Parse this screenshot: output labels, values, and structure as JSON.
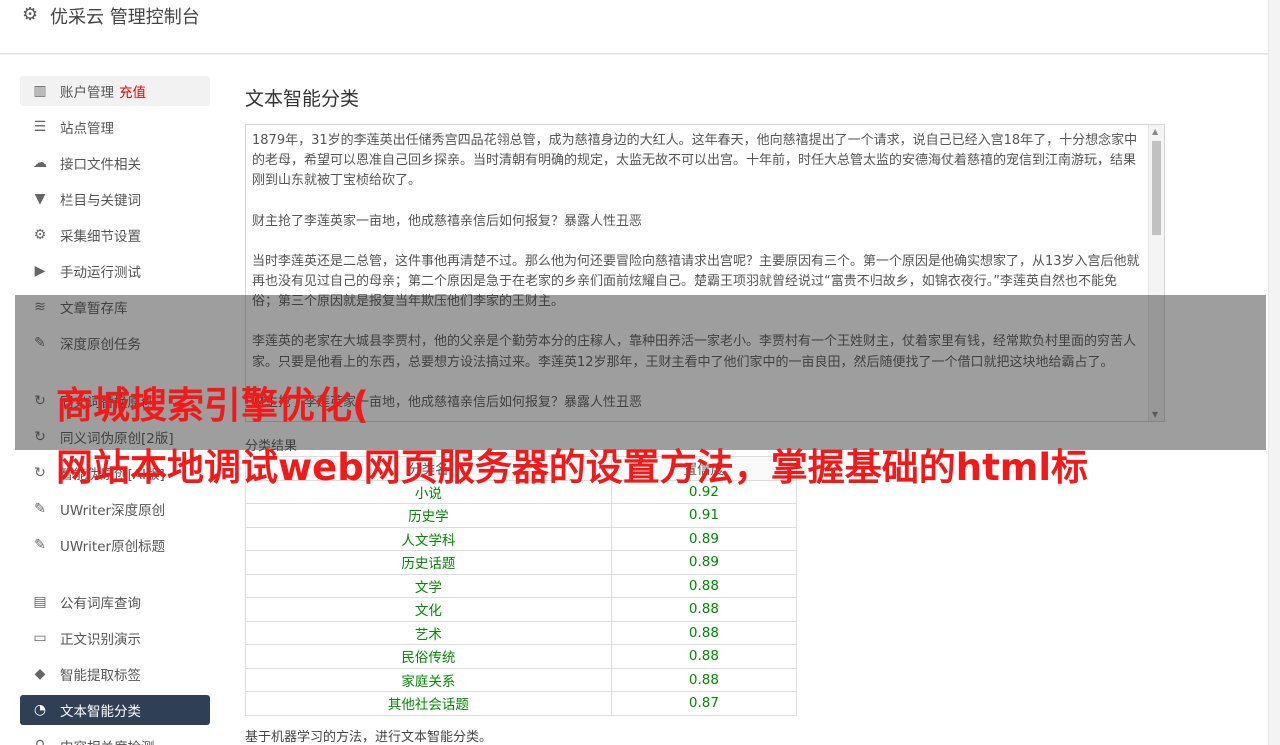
{
  "header": {
    "gear_icon": "gear-icon",
    "title": "优采云 管理控制台"
  },
  "sidebar": {
    "items": [
      {
        "icon": "bar-chart-icon",
        "glyph": "▥",
        "label": "账户管理",
        "badge": "充值"
      },
      {
        "icon": "server-icon",
        "glyph": "☰",
        "label": "站点管理"
      },
      {
        "icon": "cloud-upload-icon",
        "glyph": "☁",
        "label": "接口文件相关"
      },
      {
        "icon": "filter-icon",
        "glyph": "▼",
        "label": "栏目与关键词"
      },
      {
        "icon": "gears-icon",
        "glyph": "⚙",
        "label": "采集细节设置"
      },
      {
        "icon": "play-icon",
        "glyph": "▶",
        "label": "手动运行测试"
      },
      {
        "icon": "database-icon",
        "glyph": "≋",
        "label": "文章暂存库"
      },
      {
        "icon": "edit-icon",
        "glyph": "✎",
        "label": "深度原创任务"
      },
      {
        "icon": "refresh-icon",
        "glyph": "↻",
        "label": "同义词替换原创"
      },
      {
        "icon": "refresh-icon",
        "glyph": "↻",
        "label": "同义词伪原创[2版]"
      },
      {
        "icon": "refresh-icon",
        "glyph": "↻",
        "label": "智能伪原创[AI版]"
      },
      {
        "icon": "edit-icon",
        "glyph": "✎",
        "label": "UWriter深度原创"
      },
      {
        "icon": "edit-icon",
        "glyph": "✎",
        "label": "UWriter原创标题"
      },
      {
        "icon": "book-icon",
        "glyph": "▤",
        "label": "公有词库查询"
      },
      {
        "icon": "monitor-icon",
        "glyph": "▭",
        "label": "正文识别演示"
      },
      {
        "icon": "tag-icon",
        "glyph": "◆",
        "label": "智能提取标签"
      },
      {
        "icon": "pie-chart-icon",
        "glyph": "◔",
        "label": "文本智能分类"
      },
      {
        "icon": "search-icon",
        "glyph": "⚲",
        "label": "内容相关度检测"
      }
    ]
  },
  "main": {
    "title": "文本智能分类",
    "paragraphs": [
      "1879年，31岁的李莲英出任储秀宫四品花翎总管，成为慈禧身边的大红人。这年春天，他向慈禧提出了一个请求，说自己已经入宫18年了，十分想念家中的老母，希望可以恩准自己回乡探亲。当时清朝有明确的规定，太监无故不可以出宫。十年前，时任大总管太监的安德海仗着慈禧的宠信到江南游玩，结果刚到山东就被丁宝桢给砍了。",
      "财主抢了李莲英家一亩地，他成慈禧亲信后如何报复？暴露人性丑恶",
      "当时李莲英还是二总管，这件事他再清楚不过。那么他为何还要冒险向慈禧请求出宫呢？主要原因有三个。第一个原因是他确实想家了，从13岁入宫后他就再也没有见过自己的母亲；第二个原因是急于在老家的乡亲们面前炫耀自己。楚霸王项羽就曾经说过“富贵不归故乡，如锦衣夜行。”李莲英自然也不能免俗；第三个原因就是报复当年欺压他们李家的王财主。",
      "李莲英的老家在大城县李贾村，他的父亲是个勤劳本分的庄稼人，靠种田养活一家老小。李贾村有一个王姓财主，仗着家里有钱，经常欺负村里面的穷苦人家。只要是他看上的东西，总要想方设法搞过来。李莲英12岁那年，王财主看中了他们家中的一亩良田，然后随便找了一个借口就把这块地给霸占了。",
      "财主抢了李莲英家一亩地，他成慈禧亲信后如何报复？暴露人性丑恶"
    ],
    "result_label": "分类结果",
    "table": {
      "headers": [
        "分类名",
        "置信度"
      ],
      "rows": [
        [
          "小说",
          "0.92"
        ],
        [
          "历史学",
          "0.91"
        ],
        [
          "人文学科",
          "0.89"
        ],
        [
          "历史话题",
          "0.89"
        ],
        [
          "文学",
          "0.88"
        ],
        [
          "文化",
          "0.88"
        ],
        [
          "艺术",
          "0.88"
        ],
        [
          "民俗传统",
          "0.88"
        ],
        [
          "家庭关系",
          "0.88"
        ],
        [
          "其他社会话题",
          "0.87"
        ]
      ]
    },
    "description": "基于机器学习的方法，进行文本智能分类。"
  },
  "overlay": {
    "line1": "商城搜索引擎优化(",
    "line2": "网站本地调试web网页服务器的设置方法，掌握基础的html标"
  },
  "colors": {
    "active_nav": "#2f4056",
    "result_value": "#008800",
    "overlay_text": "#f01a1a",
    "badge": "#ee0000"
  }
}
